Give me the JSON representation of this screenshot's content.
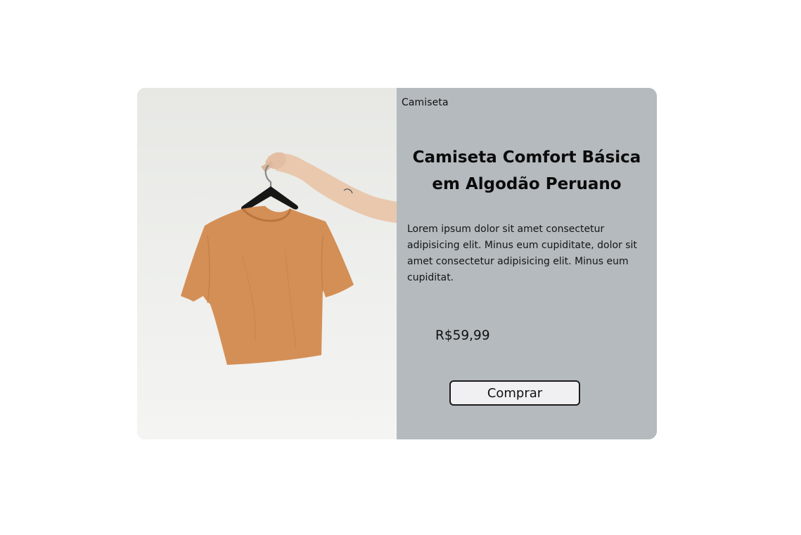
{
  "product": {
    "category": "Camiseta",
    "title": "Camiseta Comfort Básica em Algodão Peruano",
    "description": "Lorem ipsum dolor sit amet consectetur adipisicing elit. Minus eum cupiditate, dolor sit amet consectetur adipisicing elit. Minus eum cupiditat.",
    "price": "R$59,99",
    "buy_label": "Comprar",
    "image_icon": "tshirt-on-hanger-photo"
  },
  "colors": {
    "panel": "#b4babe",
    "shirt": "#d48f56",
    "button_bg": "#f0f0f2"
  }
}
